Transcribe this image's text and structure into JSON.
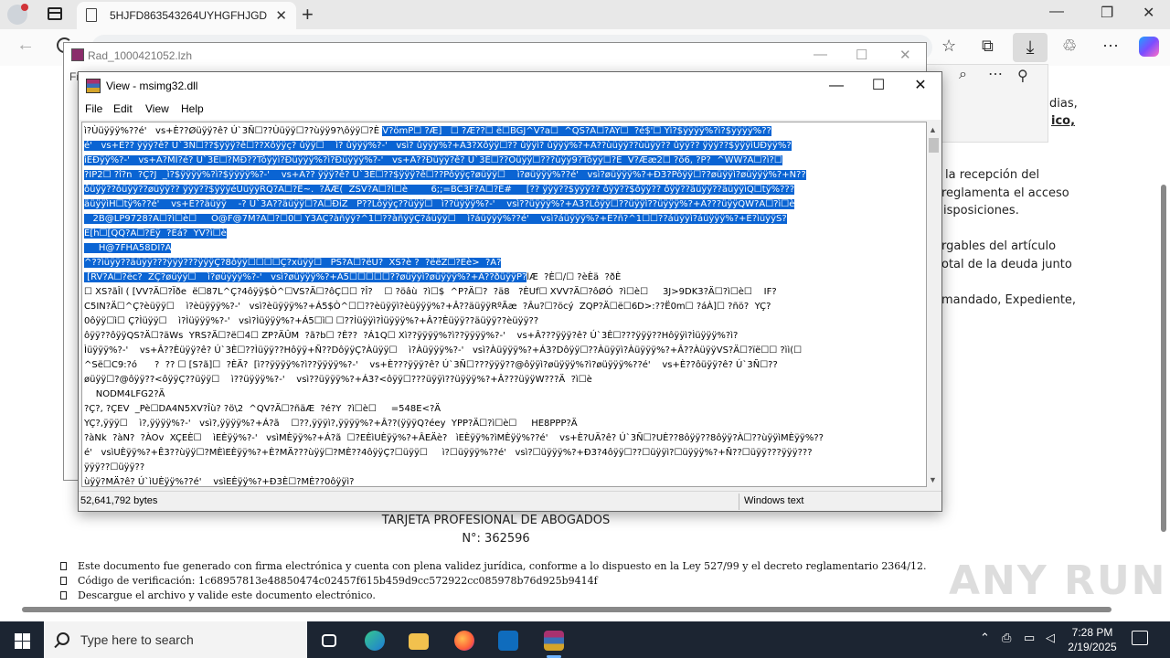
{
  "browser": {
    "tab_title": "5HJFD863543264UYHGFHJGDF86",
    "tab_close": "✕",
    "new_tab": "+",
    "window_min": "—",
    "window_restore": "❐",
    "window_close": "✕"
  },
  "page": {
    "right_snippets": [
      "dias,",
      "ico,",
      "la recepción del",
      "reglamenta el acceso",
      "isposiciones.",
      "rgables del artículo",
      "otal de la deuda junto",
      "mandado, Expediente,"
    ],
    "card_title": "TARJETA PROFESIONAL DE ABOGADOS",
    "card_number": "N°: 362596",
    "bullets": [
      "Este documento fue generado con firma electrónica y cuenta con plena validez jurídica, conforme a lo dispuesto en la Ley 527/99 y el decreto reglamentario 2364/12.",
      "Código de verificación: 1c68957813e48850474c02457f615b459d9cc572922cc085978b76d925b9414f",
      "Descargue el archivo y valide este documento electrónico."
    ]
  },
  "rad_window": {
    "title": "Rad_1000421052.lzh",
    "left_letter": "Fi",
    "min": "—",
    "max": "☐",
    "close": "✕"
  },
  "view_window": {
    "title": "View - msimg32.dll",
    "min": "—",
    "max": "☐",
    "close": "✕",
    "menu": [
      "File",
      "Edit",
      "View",
      "Help"
    ],
    "status_size": "52,641,792 bytes",
    "status_encoding": "Windows text",
    "lines": [
      {
        "t": "ì?Ùüÿÿÿ%??é'   vs+È??Øüÿÿ?ê? Ú`3Ñ☐??Ùüÿÿ☐??ùÿÿ9?\\ôÿÿ☐?È ",
        "s": "V?ömP☐ ?Æ]   ☐ ?Æ??☐ ë☐BGJ^V?a☐  ^QS?Ä☐?ÁÝ☐  ?é$'☐ Yì?$ÿÿÿÿ%?ì?$ÿÿÿÿ%??"
      },
      {
        "t": "",
        "s": "é'   vs+È?? ÿÿÿ?ê? Ú`3Ñ☐??$ÿÿÿ?ê☐??Xôÿÿç? ûÿÿ☐    ì? ûÿÿÿ%?-'   vsì? ûÿÿÿ%?+Á3?Xôÿÿ☐?? ûÿÿì? ûÿÿÿ%?+Â??ùüÿÿ??ùüÿÿ?? ûÿÿ?? ÿÿÿ??$ÿÿÿìUÐÿÿ%?"
      },
      {
        "t": "",
        "s": "ìEÐÿÿ%?-'   vs+Á?MÌ?é? Ú`3È☐?MÐ??Tôÿÿì?Ðüÿÿÿ%?ì?Ðüÿÿÿ%?-'   vs+Â??Ðüÿÿ?ê? Ú`3È☐??Ôüÿÿ☐???ùÿÿ9?Tôÿÿ☐?È  V?Ææ2☐ ?õ6, ?P?  ^WW?Ä☐?ì?☐"
      },
      {
        "t": "",
        "s": "?ÏP2☐ ?î?n  ?Ç?J  _ì?$ÿÿÿÿ%?ì?$ÿÿÿÿ%?-'    vs+Â?? ÿÿÿ?ê? Ú`3È☐??$ÿÿÿ?ê☐??Pôÿÿç?øüÿÿ☐    ì?øüÿÿÿ%??é'   vsì?øüÿÿÿ%?+Ð3?Pôÿÿ☐??øüÿÿì?øüÿÿÿ%?+Ñ??"
      },
      {
        "t": "",
        "s": "ôüÿÿ??ôüÿÿ??øüÿÿ?? ÿÿÿ??$ÿÿÿéÜüÿÿRQ?Ä☐?Ê~.  ?ÅÆ(  ZSV?Ä☐?ì☐è        6;;=BC3F?Ä☐?É#     [?? ÿÿÿ??$ÿÿÿ?? ôÿÿ??$ôÿÿ?? ôÿÿ??äüÿÿ??äüÿÿìQ☐tÿ%???"
      },
      {
        "t": "",
        "s": "äüÿÿìH☐tÿ%??é'    vs+È??äüÿÿ    -? Ú`3Ä??äüÿÿ☐?Ä☐ÐiZ   P??Lôÿÿç??üÿÿ☐   ì??üÿÿÿ%?-'    vsì??üÿÿÿ%?+À3?Lôÿÿ☐??üÿÿì??üÿÿÿ%?+Â???üÿÿQW?Ä☐?ì☐è"
      },
      {
        "t": "",
        "s": "   2B@LP9728?Ä☐?ì☐è☐     O@F@7M?Ä☐?☐0☐ Y3ÀÇ?àñÿÿ?^1☐??àñÿÿÇ?áüÿÿ☐    ì?áüÿÿÿ%??é'    vsì?áüÿÿÿ%?+Ê?ñ?^1☐☐??áüÿÿì?áüÿÿÿ%?+È?ìüÿÿS?"
      },
      {
        "t": "",
        "s": "Ë[h☐[QQ?Ä☐?Èÿ  ?Éá?  YV?ì☐è"
      },
      {
        "t": "",
        "s": "     H@7FHA58DI?Ä"
      },
      {
        "t": "",
        "s": "^??ìüÿÿ??äüÿÿ???ÿÿÿ???ÿÿÿÇ?8ôÿÿ☐☐☐☐Ç?xüÿÿ☐   PS?Ä☐?ëU?  XS?è ?  ?ëëZ☐?Ëè>  ?Ã?"
      },
      {
        "t": "lÆ  ?È☐/☐ ?èÈä  ?ðÈ",
        "s": " [RV?Ä☐?ëc?  ZÇ?øüÿÿ☐    ì?øüÿÿÿ%?-'   vsì?øüÿÿÿ%?+Á5☐☐☐☐☐??øüÿÿì?øüÿÿÿ%?+Â??ðüÿÿP?",
        "after": true
      },
      {
        "t": "☐ XS?ãÎl ( [VV?Ä☐?Ïðe  ë☐87L^Ç?4ôÿÿ$Ò^☐VS?Ä☐?ôÇ☐☐ ?Î?    ☐ ?öâù  ?ì☐$  ^P?Ä☐?  ?ä8   ?ÈUf☐ XVV?Ä☐?ôØÓ  ?ì☐è☐     3J>9DK3?Ä☐?ì☐è☐    IF?"
      },
      {
        "t": "C5IN?Ä☐^Ç?èüÿÿ☐    ì?èüÿÿÿ%?-'   vsì?èüÿÿÿ%?+Á5$Ò^☐☐??èüÿÿì?èüÿÿÿ%?+Â??äüÿÿRºÃæ  ?Âu?☐?öcý  ZQP?Ä☐ë☐6D>:??Ë0m☐ ?áÀ]☐ ?ñö?  YÇ?"
      },
      {
        "t": "0ôÿÿ☐ì☐ Ç?Ìüÿÿ☐    ì?Ìüÿÿÿ%?-'   vsì?Ìüÿÿÿ%?+Á5☐ì☐ ☐??Ìüÿÿì?Ìüÿÿÿ%?+Â??Èüÿÿ??äüÿÿ??èüÿÿ??"
      },
      {
        "t": "ôÿÿ??ôÿÿQS?Ä☐?äWs  YRS?Ä☐?ë☐4☐ ZP?ÄÛM  ?ã?b☐ ?È??  ?Á1Q☐ Xì??ÿÿÿÿ%?ì??ÿÿÿÿ%?-'    vs+Â???ÿÿÿ?ê? Ú`3È☐???ÿÿÿ??Hôÿÿì?Ìüÿÿÿ%?ì?"
      },
      {
        "t": "Ìüÿÿÿ%?-'    vs+Â??Èüÿÿ?ê? Ú`3È☐??Ìüÿÿ??Hôÿÿ+Ñ??DôÿÿÇ?Àüÿÿ☐    ì?Àüÿÿÿ%?-'   vsì?Àüÿÿÿ%?+Á3?Dôÿÿ☐??Àüÿÿì?Àüÿÿÿ%?+Â??ÀüÿÿVS?Ä☐?ïë☐☐ ?ìì(☐"
      },
      {
        "t": "^Së☐C9:?ó      ?  ?? ☐ [S?ã]☐  ?ÈÄ?  [ì??ÿÿÿÿ%?ì??ÿÿÿÿ%?-'    vs+È???ÿÿÿ?ê? Ú`3Ñ☐???ÿÿÿ??@ôÿÿì?øüÿÿÿ%?ì?øüÿÿÿ%??é'    vs+È??ôüÿÿ?ê? Ú`3Ñ☐??"
      },
      {
        "t": "øüÿÿ☐?@ôÿÿ??<ôÿÿÇ??üÿÿ☐    ì??üÿÿÿ%?-'    vsì??üÿÿÿ%?+Á3?<ôÿÿ☐???üÿÿì??üÿÿÿ%?+Â???üÿÿW???Ä  ?ì☐è"
      },
      {
        "t": "    NODM4LFG2?Ä"
      },
      {
        "t": "?Ç?, ?ÇEV  _Pè☐DA4N5XV?Îù? ?ö\\2  ^QV?Ä☐?ñäÆ  ?é?Y  ?ì☐è☐     =548E<?Ä"
      },
      {
        "t": "YÇ?,ÿÿÿ☐    ì?,ÿÿÿÿ%?-'   vsì?,ÿÿÿÿ%?+Á?ã    ☐??,ÿÿÿì?,ÿÿÿÿ%?+Â??(ÿÿÿQ?éey  YPP?Ä☐?ì☐è☐     HE8PPP?Ä"
      },
      {
        "t": "?àNk  ?àN?  ?ÀOv  XÇEÈ☐    ìEÈÿÿ%?-'   vsìMÈÿÿ%?+Á?ã  ☐?EÈìUÈÿÿ%?+ÂEÄè?   ìEÈÿÿ%?ìMÈÿÿ%??é'    vs+È?UÄ?ê? Ú`3Ñ☐?UÈ??8ôÿÿ??8ôÿÿ?À☐??ùÿÿìMÈÿÿ%??"
      },
      {
        "t": "é'   vsìUÈÿÿ%?+Ê3??ùÿÿ☐?MÈìEÈÿÿ%?+È?MÄ???ùÿÿ☐?MÈ??4ôÿÿÇ?☐üÿÿ☐     ì?☐üÿÿÿ%??é'   vsì?☐üÿÿÿ%?+Ð3?4ôÿÿ☐??☐üÿÿì?☐üÿÿÿ%?+Ñ??☐üÿÿ???ÿÿÿ???"
      },
      {
        "t": "ÿÿÿ??☐üÿÿ??"
      },
      {
        "t": "ùÿÿ?MÄ?ê? Ú`ìUÈÿÿ%??é'    vsìEÈÿÿ%?+Ð3È☐?MÈ??0ôÿÿì?"
      }
    ]
  },
  "taskbar": {
    "search_placeholder": "Type here to search",
    "time": "7:28 PM",
    "date": "2/19/2025"
  },
  "watermark": "ANY RUN"
}
